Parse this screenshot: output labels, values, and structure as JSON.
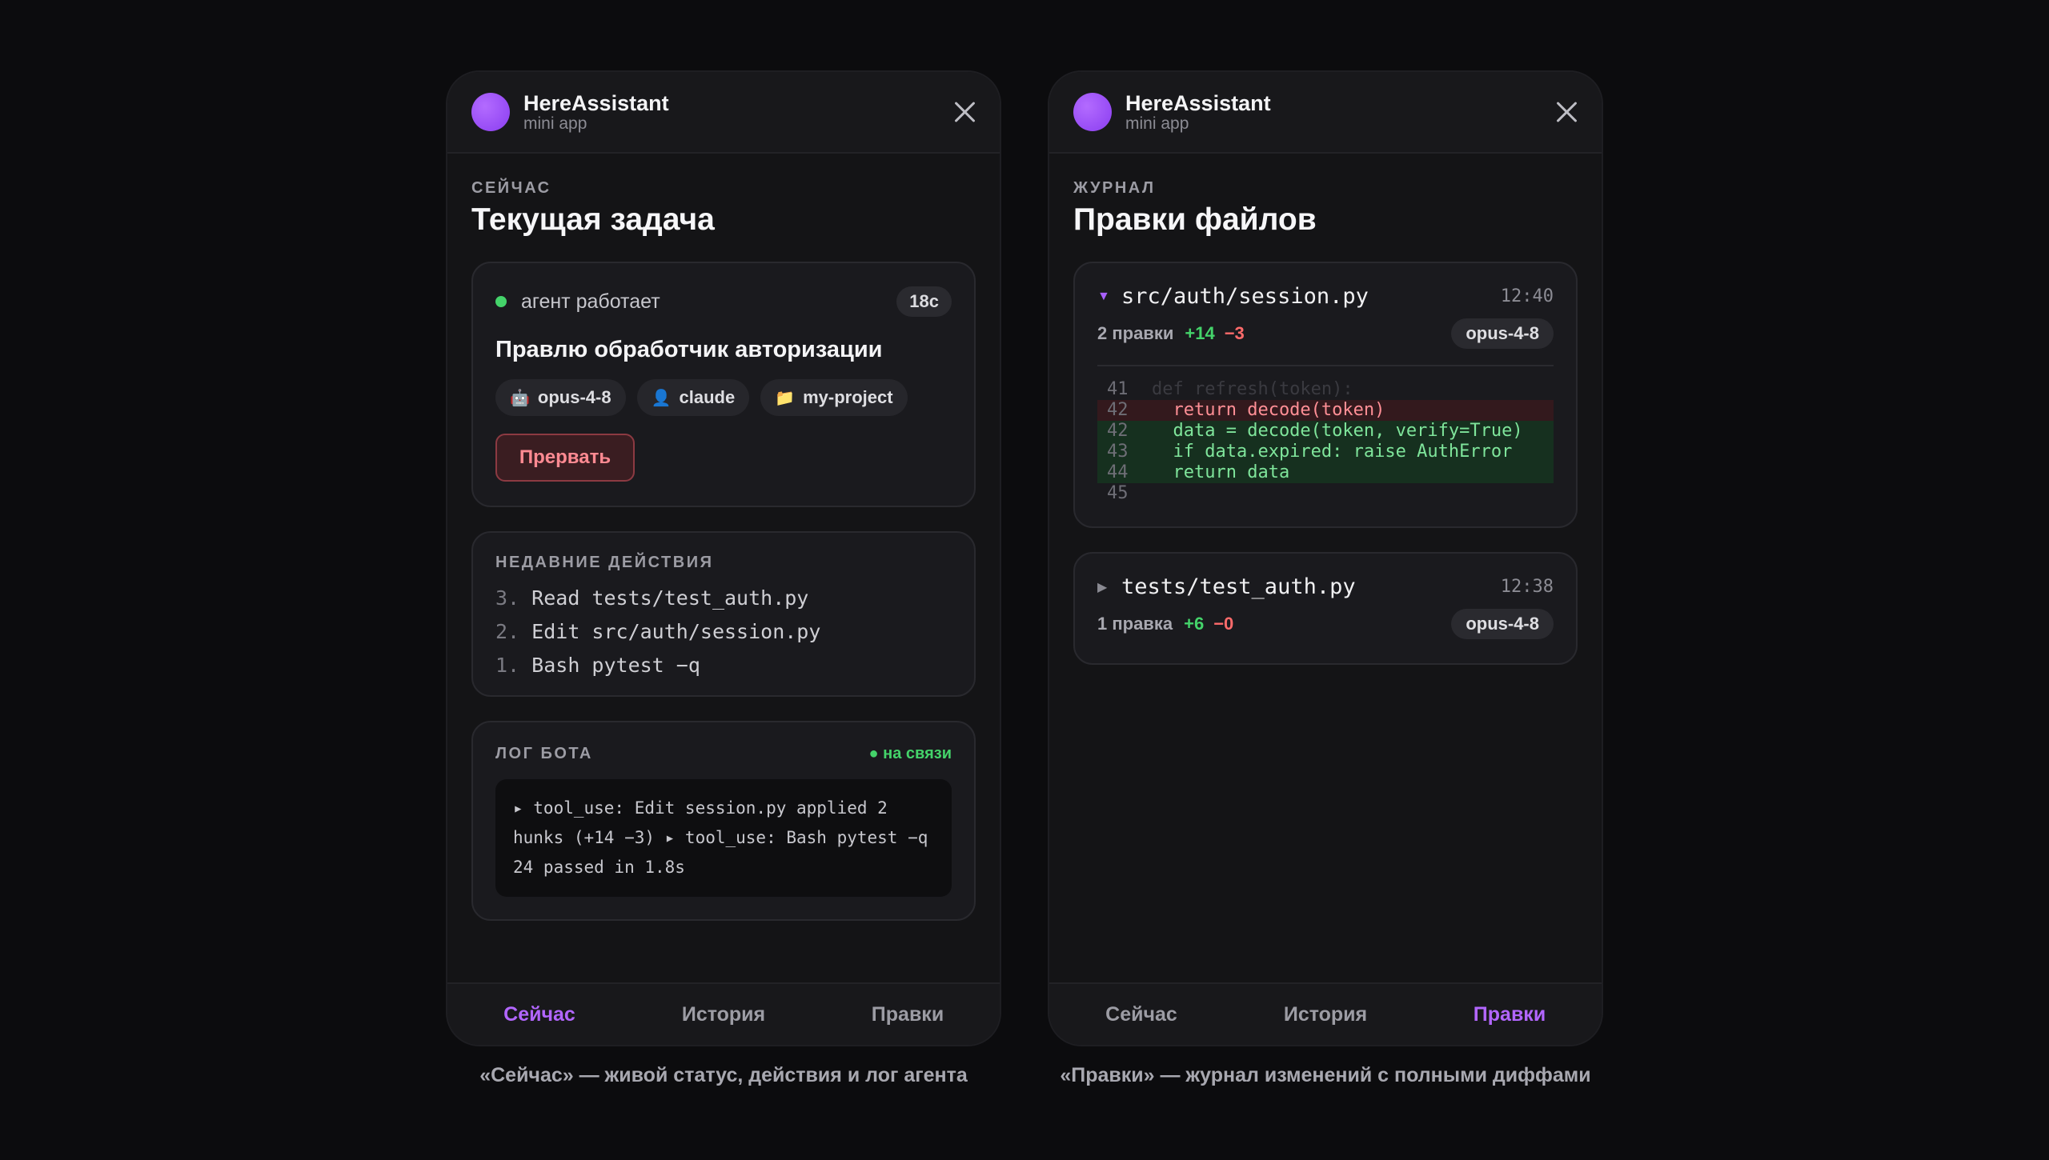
{
  "left": {
    "header": {
      "app_name": "HereAssistant",
      "app_sub": "mini app"
    },
    "kicker": "СЕЙЧАС",
    "title": "Текущая задача",
    "current": {
      "status": "агент работает",
      "elapsed": "18с",
      "task": "Правлю обработчик авторизации",
      "chips": [
        {
          "icon": "🤖",
          "label": "opus-4-8"
        },
        {
          "icon": "👤",
          "label": "claude"
        },
        {
          "icon": "📁",
          "label": "my-project"
        }
      ],
      "abort_label": "Прервать"
    },
    "recent": {
      "label": "НЕДАВНИЕ ДЕЙСТВИЯ",
      "items": [
        {
          "num": "3.",
          "text": "Read tests/test_auth.py"
        },
        {
          "num": "2.",
          "text": "Edit src/auth/session.py"
        },
        {
          "num": "1.",
          "text": "Bash pytest −q"
        }
      ]
    },
    "botlog": {
      "label": "ЛОГ БОТА",
      "online": "● на связи",
      "text": "▸ tool_use: Edit session.py applied 2 hunks (+14 −3) ▸ tool_use: Bash pytest −q 24 passed in 1.8s"
    },
    "tabs": [
      "Сейчас",
      "История",
      "Правки"
    ],
    "caption": "«Сейчас» — живой статус, действия и лог агента"
  },
  "right": {
    "header": {
      "app_name": "HereAssistant",
      "app_sub": "mini app"
    },
    "kicker": "ЖУРНАЛ",
    "title": "Правки файлов",
    "files": [
      {
        "caret": "▼",
        "name": "src/auth/session.py",
        "time": "12:40",
        "count": "2 правки",
        "plus": "+14",
        "minus": "−3",
        "model": "opus-4-8",
        "diff": [
          {
            "ln": "41",
            "code": "def refresh(token):"
          },
          {
            "ln": "42",
            "code": "  return decode(token)"
          },
          {
            "ln": "42",
            "code": "  data = decode(token, verify=True)"
          },
          {
            "ln": "43",
            "code": "  if data.expired: raise AuthError"
          },
          {
            "ln": "44",
            "code": "  return data"
          },
          {
            "ln": "45",
            "code": ""
          }
        ]
      },
      {
        "caret": "▶",
        "name": "tests/test_auth.py",
        "time": "12:38",
        "count": "1 правка",
        "plus": "+6",
        "minus": "−0",
        "model": "opus-4-8"
      }
    ],
    "tabs": [
      "Сейчас",
      "История",
      "Правки"
    ],
    "caption": "«Правки» — журнал изменений с полными диффами"
  },
  "colors": {
    "accent": "#b266ff",
    "online": "#44d36a",
    "danger": "#ff6b6b"
  },
  "icons": [
    "close-icon",
    "robot-icon",
    "user-icon",
    "folder-icon",
    "caret-down-icon",
    "caret-right-icon"
  ]
}
